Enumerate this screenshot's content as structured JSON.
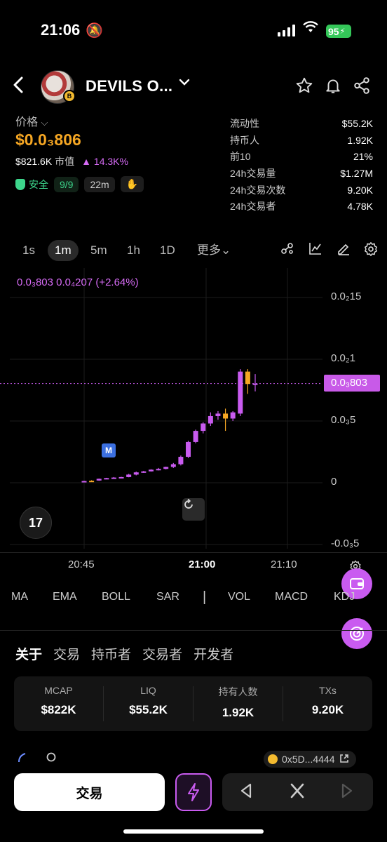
{
  "status": {
    "time": "21:06",
    "battery": "95"
  },
  "header": {
    "token_name": "DEVILS O...",
    "chain_badge": "B"
  },
  "price_block": {
    "price_label": "价格",
    "price": "$0.0₃806",
    "mcap_value": "$821.6K",
    "mcap_label": "市值",
    "change": "▲ 14.3K%",
    "safe_label": "安全",
    "safe_score": "9/9",
    "age": "22m",
    "hand_icon": "✋"
  },
  "stats": [
    {
      "k": "流动性",
      "v": "$55.2K"
    },
    {
      "k": "持币人",
      "v": "1.92K"
    },
    {
      "k": "前10",
      "v": "21%"
    },
    {
      "k": "24h交易量",
      "v": "$1.27M"
    },
    {
      "k": "24h交易次数",
      "v": "9.20K"
    },
    {
      "k": "24h交易者",
      "v": "4.78K"
    }
  ],
  "intervals": {
    "s1": "1s",
    "m1": "1m",
    "m5": "5m",
    "h1": "1h",
    "d1": "1D",
    "more": "更多⌄",
    "active": "1m"
  },
  "chart": {
    "legend": "0.0₃803  0.0₄207 (+2.64%)",
    "current_price_tag": "0.0₃803",
    "y_labels": [
      "0.0₂15",
      "0.0₂1",
      "0.0₃5",
      "0",
      "-0.0₃5"
    ],
    "x_labels": [
      "20:45",
      "21:00",
      "21:10"
    ],
    "tv_logo": "17",
    "marker": "M"
  },
  "chart_data": {
    "type": "candlestick",
    "x_labels": [
      "20:45",
      "21:00",
      "21:10"
    ],
    "y_ticks": [
      "0.0₂15",
      "0.0₂1",
      "0.0₃5",
      "0",
      "-0.0₃5"
    ],
    "ylim": [
      -0.0005,
      0.0015
    ],
    "last_price": 0.000803,
    "candles": [
      {
        "o": 1.2e-05,
        "h": 1.6e-05,
        "l": 1e-05,
        "c": 1.4e-05,
        "up": true
      },
      {
        "o": 1.6e-05,
        "h": 2e-05,
        "l": 1.2e-05,
        "c": 1.4e-05,
        "up": false
      },
      {
        "o": 1.8e-05,
        "h": 3.4e-05,
        "l": 1.6e-05,
        "c": 3.2e-05,
        "up": true
      },
      {
        "o": 3.2e-05,
        "h": 4e-05,
        "l": 3e-05,
        "c": 3.8e-05,
        "up": true
      },
      {
        "o": 3.8e-05,
        "h": 4.6e-05,
        "l": 3.5e-05,
        "c": 4.2e-05,
        "up": true
      },
      {
        "o": 4.2e-05,
        "h": 4.8e-05,
        "l": 4e-05,
        "c": 4.6e-05,
        "up": true
      },
      {
        "o": 4.6e-05,
        "h": 7.2e-05,
        "l": 4.4e-05,
        "c": 6.6e-05,
        "up": true
      },
      {
        "o": 6.6e-05,
        "h": 9e-05,
        "l": 6e-05,
        "c": 8.4e-05,
        "up": true
      },
      {
        "o": 8.4e-05,
        "h": 9.6e-05,
        "l": 8e-05,
        "c": 9.2e-05,
        "up": true
      },
      {
        "o": 9.2e-05,
        "h": 0.00011,
        "l": 9e-05,
        "c": 0.000106,
        "up": true
      },
      {
        "o": 0.000106,
        "h": 0.00012,
        "l": 0.0001,
        "c": 0.000112,
        "up": true
      },
      {
        "o": 0.000112,
        "h": 0.00013,
        "l": 0.000108,
        "c": 0.000128,
        "up": true
      },
      {
        "o": 0.000128,
        "h": 0.00016,
        "l": 0.00012,
        "c": 0.00015,
        "up": true
      },
      {
        "o": 0.00015,
        "h": 0.00022,
        "l": 0.00014,
        "c": 0.00021,
        "up": true
      },
      {
        "o": 0.00021,
        "h": 0.00034,
        "l": 0.0002,
        "c": 0.00033,
        "up": true
      },
      {
        "o": 0.00033,
        "h": 0.00043,
        "l": 0.00032,
        "c": 0.00042,
        "up": true
      },
      {
        "o": 0.00042,
        "h": 0.00049,
        "l": 0.0004,
        "c": 0.00048,
        "up": true
      },
      {
        "o": 0.00048,
        "h": 0.00057,
        "l": 0.00046,
        "c": 0.00054,
        "up": true
      },
      {
        "o": 0.00054,
        "h": 0.00058,
        "l": 0.00051,
        "c": 0.00056,
        "up": true
      },
      {
        "o": 0.00056,
        "h": 0.0006,
        "l": 0.00042,
        "c": 0.00052,
        "up": false
      },
      {
        "o": 0.00052,
        "h": 0.00058,
        "l": 0.0005,
        "c": 0.00057,
        "up": true
      },
      {
        "o": 0.00056,
        "h": 0.00092,
        "l": 0.00054,
        "c": 0.0009,
        "up": true
      },
      {
        "o": 0.0009,
        "h": 0.00092,
        "l": 0.00072,
        "c": 0.0008,
        "up": false
      },
      {
        "o": 0.0008,
        "h": 0.00088,
        "l": 0.00074,
        "c": 0.000803,
        "up": true
      }
    ]
  },
  "indicators": [
    "MA",
    "EMA",
    "BOLL",
    "SAR",
    "VOL",
    "MACD",
    "KDJ"
  ],
  "section_tabs": [
    "关于",
    "交易",
    "持币者",
    "交易者",
    "开发者"
  ],
  "summary": [
    {
      "k": "MCAP",
      "v": "$822K"
    },
    {
      "k": "LIQ",
      "v": "$55.2K"
    },
    {
      "k": "持有人数",
      "v": "1.92K"
    },
    {
      "k": "TXs",
      "v": "9.20K"
    }
  ],
  "address": {
    "short": "0x5D...4444"
  },
  "bottom": {
    "trade_label": "交易"
  },
  "colors": {
    "accent": "#c95bf0",
    "price": "#f5a623",
    "up": "#c95bf0",
    "down": "#f5a623",
    "safe": "#3dd68c"
  }
}
